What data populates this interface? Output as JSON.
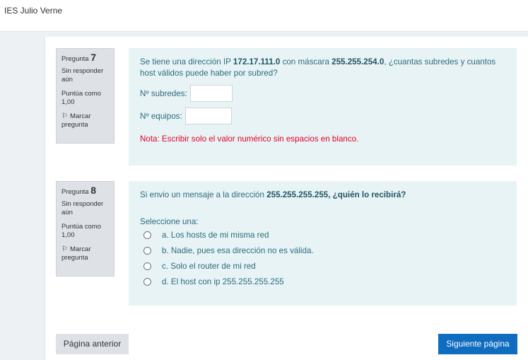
{
  "site": {
    "name": "IES Julio Verne"
  },
  "questions": [
    {
      "label": "Pregunta",
      "number": "7",
      "state": "Sin responder aún",
      "grade": "Puntúa como 1,00",
      "flag": "Marcar pregunta",
      "text": {
        "p1": "Se tiene una dirección IP ",
        "ip": "172.17.111.0",
        "p2": " con máscara ",
        "mask": "255.255.254.0",
        "p3": ", ¿cuantas subredes y cuantos host válidos puede haber por subred?"
      },
      "fields": [
        {
          "label": "Nº subredes:",
          "value": ""
        },
        {
          "label": "Nº equipos:",
          "value": ""
        }
      ],
      "note": "Nota: Escribir solo el valor numérico sin espacios en blanco."
    },
    {
      "label": "Pregunta",
      "number": "8",
      "state": "Sin responder aún",
      "grade": "Puntúa como 1,00",
      "flag": "Marcar pregunta",
      "text": {
        "p1": "Si envio un mensaje a la dirección ",
        "bold": "255.255.255.255, ¿quién lo recibirá?"
      },
      "prompt": "Seleccione una:",
      "options": [
        "a. Los hosts de mi misma red",
        "b. Nadie, pues esa dirección no es válida.",
        "c. Solo el router de mi red",
        "d. El host con ip 255.255.255.255"
      ]
    }
  ],
  "nav": {
    "prev_label": "Página anterior",
    "next_label": "Siguiente página"
  },
  "colors": {
    "content_bg": "#e7f3f5",
    "info_bg": "#dee2e6",
    "primary": "#0f6cbf",
    "note": "#e5002a"
  }
}
